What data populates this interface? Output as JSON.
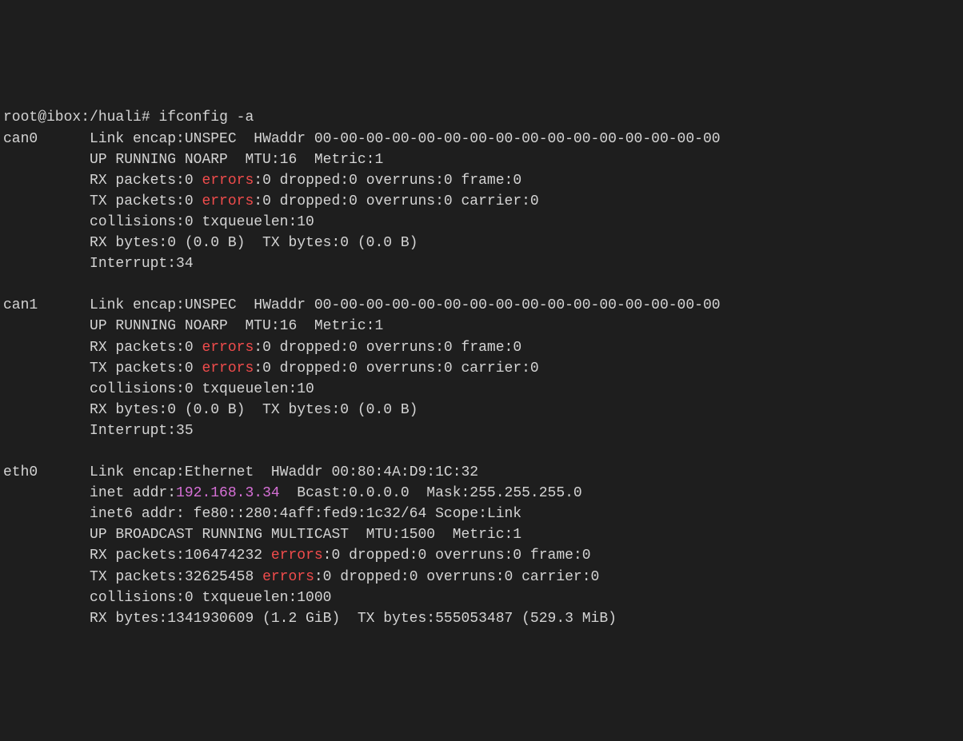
{
  "prompt": {
    "user": "root@ibox",
    "path": "/huali",
    "symbol": "#",
    "command": "ifconfig -a"
  },
  "interfaces": [
    {
      "name": "can0",
      "encap": "UNSPEC",
      "hwaddr": "00-00-00-00-00-00-00-00-00-00-00-00-00-00-00-00",
      "flags": "UP RUNNING NOARP",
      "mtu": "16",
      "metric": "1",
      "rx_packets": "0",
      "rx_errors": "0",
      "rx_dropped": "0",
      "rx_overruns": "0",
      "rx_frame": "0",
      "tx_packets": "0",
      "tx_errors": "0",
      "tx_dropped": "0",
      "tx_overruns": "0",
      "tx_carrier": "0",
      "collisions": "0",
      "txqueuelen": "10",
      "rx_bytes": "0",
      "rx_bytes_h": "(0.0 B)",
      "tx_bytes": "0",
      "tx_bytes_h": "(0.0 B)",
      "interrupt": "34",
      "inet": null,
      "bcast": null,
      "mask": null,
      "inet6": null,
      "scope": null
    },
    {
      "name": "can1",
      "encap": "UNSPEC",
      "hwaddr": "00-00-00-00-00-00-00-00-00-00-00-00-00-00-00-00",
      "flags": "UP RUNNING NOARP",
      "mtu": "16",
      "metric": "1",
      "rx_packets": "0",
      "rx_errors": "0",
      "rx_dropped": "0",
      "rx_overruns": "0",
      "rx_frame": "0",
      "tx_packets": "0",
      "tx_errors": "0",
      "tx_dropped": "0",
      "tx_overruns": "0",
      "tx_carrier": "0",
      "collisions": "0",
      "txqueuelen": "10",
      "rx_bytes": "0",
      "rx_bytes_h": "(0.0 B)",
      "tx_bytes": "0",
      "tx_bytes_h": "(0.0 B)",
      "interrupt": "35",
      "inet": null,
      "bcast": null,
      "mask": null,
      "inet6": null,
      "scope": null
    },
    {
      "name": "eth0",
      "encap": "Ethernet",
      "hwaddr": "00:80:4A:D9:1C:32",
      "inet": "192.168.3.34",
      "bcast": "0.0.0.0",
      "mask": "255.255.255.0",
      "inet6": "fe80::280:4aff:fed9:1c32/64",
      "scope": "Link",
      "flags": "UP BROADCAST RUNNING MULTICAST",
      "mtu": "1500",
      "metric": "1",
      "rx_packets": "106474232",
      "rx_errors": "0",
      "rx_dropped": "0",
      "rx_overruns": "0",
      "rx_frame": "0",
      "tx_packets": "32625458",
      "tx_errors": "0",
      "tx_dropped": "0",
      "tx_overruns": "0",
      "tx_carrier": "0",
      "collisions": "0",
      "txqueuelen": "1000",
      "rx_bytes": "1341930609",
      "rx_bytes_h": "(1.2 GiB)",
      "tx_bytes": "555053487",
      "tx_bytes_h": "(529.3 MiB)",
      "interrupt": null
    }
  ],
  "labels": {
    "link_encap": "Link encap:",
    "hwaddr": "HWaddr",
    "mtu": "MTU:",
    "metric": "Metric:",
    "rx_packets": "RX packets:",
    "tx_packets": "TX packets:",
    "errors": "errors",
    "dropped": "dropped:",
    "overruns": "overruns:",
    "frame": "frame:",
    "carrier": "carrier:",
    "collisions": "collisions:",
    "txqueuelen": "txqueuelen:",
    "rx_bytes": "RX bytes:",
    "tx_bytes": "TX bytes:",
    "interrupt": "Interrupt:",
    "inet_addr": "inet addr:",
    "bcast": "Bcast:",
    "mask": "Mask:",
    "inet6_addr": "inet6 addr:",
    "scope": "Scope:"
  }
}
